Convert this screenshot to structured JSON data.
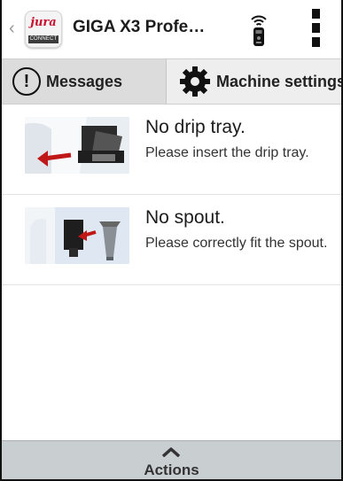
{
  "header": {
    "title": "GIGA X3 Profe…",
    "logo_brand": "jura",
    "logo_badge": "CONNECT",
    "back_icon": "chevron-left-icon",
    "remote_icon": "remote-wifi-icon",
    "menu_icon": "more-vertical-icon"
  },
  "tabs": [
    {
      "label": "Messages",
      "icon": "exclamation-circle-icon",
      "selected": true
    },
    {
      "label": "Machine settings",
      "icon": "gear-icon",
      "selected": false
    }
  ],
  "messages": [
    {
      "title": "No drip tray.",
      "body": "Please insert the drip tray.",
      "image": "drip-tray-illustration"
    },
    {
      "title": "No spout.",
      "body": "Please correctly fit the spout.",
      "image": "spout-illustration"
    }
  ],
  "actions": {
    "label": "Actions",
    "icon": "chevron-up-icon"
  },
  "colors": {
    "accent_red": "#c8102e",
    "tab_active_bg": "#dcdcdc",
    "actions_bg": "#c9ced1"
  }
}
